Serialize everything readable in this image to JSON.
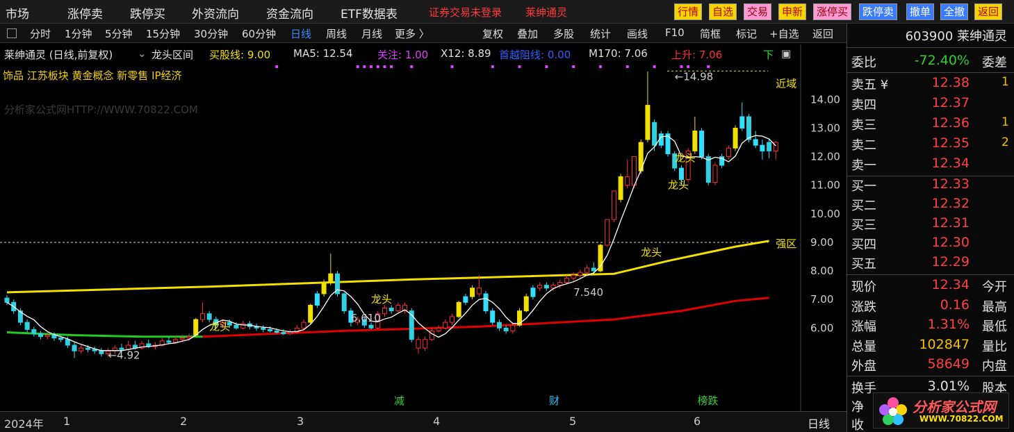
{
  "top_menu": {
    "items": [
      "市场",
      "涨停卖",
      "跌停买",
      "外资流向",
      "资金流向",
      "ETF数据表"
    ],
    "login_text": "证券交易未登录",
    "stock_name": "莱绅通灵",
    "quick_buttons": [
      {
        "label": "行情",
        "color": "#f5d400"
      },
      {
        "label": "自选",
        "color": "#f5d400"
      },
      {
        "label": "交易",
        "color": "#ff9ad5"
      },
      {
        "label": "申新",
        "color": "#f5d400"
      },
      {
        "label": "涨停买",
        "color": "#ff9ad5"
      },
      {
        "label": "跌停卖",
        "color": "#3a7bff"
      },
      {
        "label": "撤单",
        "color": "#3a7bff"
      },
      {
        "label": "全撤",
        "color": "#3a7bff"
      },
      {
        "label": "返回",
        "color": "#f5d400"
      }
    ]
  },
  "toolbar": {
    "periods": [
      "分时",
      "1分钟",
      "5分钟",
      "15分钟",
      "30分钟",
      "60分钟",
      "日线",
      "周线",
      "月线",
      "更多 〉"
    ],
    "active_period": "日线",
    "actions": [
      "复权",
      "叠加",
      "多股",
      "统计",
      "画线",
      "F10",
      "简框",
      "标记",
      "+自选",
      "返回"
    ]
  },
  "chart_header": {
    "title": "莱绅通灵 (日线,前复权)",
    "formula": "龙头区间",
    "indicators": [
      {
        "text": "买股线: 9.00",
        "color": "#f2e000"
      },
      {
        "text": "MA5: 12.54",
        "color": "#e0e0e0"
      },
      {
        "text": "关注: 1.00",
        "color": "#e040ff"
      },
      {
        "text": "X12: 8.89",
        "color": "#e0e0e0"
      },
      {
        "text": "首越阻线: 0.00",
        "color": "#3060ff"
      },
      {
        "text": "M170: 7.06",
        "color": "#e0e0e0"
      },
      {
        "text": "上升: 7.06",
        "color": "#ff3030"
      },
      {
        "text": "下",
        "color": "#30e030"
      }
    ],
    "tags": "饰品 江苏板块 黄金概念 新零售 IP经济",
    "watermark": "分析家公式网HTTP://WWW.70822.COM"
  },
  "quote": {
    "code_name": "603900 莱绅通灵",
    "ratio_label": "委比",
    "ratio_value": "-72.40%",
    "ratio_right": "委差",
    "sell": [
      {
        "label": "卖五 ¥",
        "price": "12.38",
        "vol": "1"
      },
      {
        "label": "卖四",
        "price": "12.37",
        "vol": ""
      },
      {
        "label": "卖三",
        "price": "12.36",
        "vol": "1"
      },
      {
        "label": "卖二",
        "price": "12.35",
        "vol": "2"
      },
      {
        "label": "卖一",
        "price": "12.34",
        "vol": ""
      }
    ],
    "buy": [
      {
        "label": "买一",
        "price": "12.33"
      },
      {
        "label": "买二",
        "price": "12.32"
      },
      {
        "label": "买三",
        "price": "12.31"
      },
      {
        "label": "买四",
        "price": "12.30"
      },
      {
        "label": "买五",
        "price": "12.29"
      }
    ],
    "stats": [
      {
        "label": "现价",
        "value": "12.34",
        "right": "今开",
        "color": "#ff4040"
      },
      {
        "label": "涨跌",
        "value": "0.16",
        "right": "最高",
        "color": "#ff4040"
      },
      {
        "label": "涨幅",
        "value": "1.31%",
        "right": "最低",
        "color": "#ff4040"
      },
      {
        "label": "总量",
        "value": "102847",
        "right": "量比",
        "color": "#f2c000"
      },
      {
        "label": "外盘",
        "value": "58649",
        "right": "内盘",
        "color": "#ff4040"
      }
    ],
    "turnover_label": "换手",
    "turnover_value": "3.01%",
    "turnover_right": "股本",
    "net_label": "净",
    "income_label": "收"
  },
  "bottom_axis": {
    "year": "2024年",
    "months": [
      "1",
      "2",
      "3",
      "4",
      "5",
      "6"
    ],
    "period_label": "日线"
  },
  "logo": {
    "text": "分析家公式网",
    "url": "WWW.70822.COM"
  },
  "chart_data": {
    "type": "candlestick",
    "y_ticks": [
      "14.00",
      "13.00",
      "12.00",
      "11.00",
      "10.00",
      "9.00",
      "8.00",
      "7.00",
      "6.00"
    ],
    "ylim": [
      4.5,
      15.2
    ],
    "candles": [
      {
        "o": 7.05,
        "c": 6.9,
        "h": 7.15,
        "l": 6.8,
        "kind": "down"
      },
      {
        "o": 6.9,
        "c": 6.6,
        "h": 7.0,
        "l": 6.5,
        "kind": "down"
      },
      {
        "o": 6.6,
        "c": 6.2,
        "h": 6.7,
        "l": 6.1,
        "kind": "down"
      },
      {
        "o": 6.2,
        "c": 5.95,
        "h": 6.3,
        "l": 5.85,
        "kind": "down"
      },
      {
        "o": 5.95,
        "c": 5.8,
        "h": 6.05,
        "l": 5.7,
        "kind": "down"
      },
      {
        "o": 5.8,
        "c": 5.7,
        "h": 5.9,
        "l": 5.6,
        "kind": "down"
      },
      {
        "o": 5.7,
        "c": 5.75,
        "h": 5.85,
        "l": 5.6,
        "kind": "up"
      },
      {
        "o": 5.75,
        "c": 5.65,
        "h": 5.85,
        "l": 5.55,
        "kind": "down"
      },
      {
        "o": 5.65,
        "c": 5.6,
        "h": 5.75,
        "l": 5.5,
        "kind": "down"
      },
      {
        "o": 5.6,
        "c": 5.4,
        "h": 5.7,
        "l": 5.3,
        "kind": "down"
      },
      {
        "o": 5.4,
        "c": 5.2,
        "h": 5.5,
        "l": 4.95,
        "kind": "down"
      },
      {
        "o": 5.2,
        "c": 5.3,
        "h": 5.4,
        "l": 5.1,
        "kind": "up"
      },
      {
        "o": 5.3,
        "c": 5.25,
        "h": 5.4,
        "l": 5.15,
        "kind": "down"
      },
      {
        "o": 5.25,
        "c": 5.2,
        "h": 5.35,
        "l": 5.1,
        "kind": "down"
      },
      {
        "o": 5.2,
        "c": 5.1,
        "h": 5.3,
        "l": 5.0,
        "kind": "down"
      },
      {
        "o": 5.1,
        "c": 5.2,
        "h": 5.3,
        "l": 5.0,
        "kind": "up"
      },
      {
        "o": 5.2,
        "c": 5.3,
        "h": 5.4,
        "l": 5.1,
        "kind": "up"
      },
      {
        "o": 5.3,
        "c": 5.25,
        "h": 5.45,
        "l": 5.15,
        "kind": "down"
      },
      {
        "o": 5.25,
        "c": 5.4,
        "h": 5.55,
        "l": 5.2,
        "kind": "up"
      },
      {
        "o": 5.4,
        "c": 5.3,
        "h": 5.55,
        "l": 5.25,
        "kind": "down"
      },
      {
        "o": 5.3,
        "c": 5.45,
        "h": 5.55,
        "l": 5.25,
        "kind": "up"
      },
      {
        "o": 5.45,
        "c": 5.35,
        "h": 5.6,
        "l": 5.3,
        "kind": "down"
      },
      {
        "o": 5.35,
        "c": 5.4,
        "h": 5.5,
        "l": 5.25,
        "kind": "up"
      },
      {
        "o": 5.4,
        "c": 5.55,
        "h": 5.65,
        "l": 5.35,
        "kind": "up"
      },
      {
        "o": 5.55,
        "c": 5.5,
        "h": 5.7,
        "l": 5.45,
        "kind": "down"
      },
      {
        "o": 5.5,
        "c": 5.6,
        "h": 5.7,
        "l": 5.45,
        "kind": "up"
      },
      {
        "o": 5.6,
        "c": 5.65,
        "h": 5.75,
        "l": 5.5,
        "kind": "up"
      },
      {
        "o": 5.65,
        "c": 5.7,
        "h": 5.8,
        "l": 5.55,
        "kind": "up"
      },
      {
        "o": 5.75,
        "c": 6.3,
        "h": 6.35,
        "l": 5.7,
        "kind": "yellow"
      },
      {
        "o": 6.3,
        "c": 6.5,
        "h": 6.9,
        "l": 6.2,
        "kind": "up"
      },
      {
        "o": 6.5,
        "c": 6.3,
        "h": 6.6,
        "l": 6.2,
        "kind": "down"
      },
      {
        "o": 6.3,
        "c": 6.1,
        "h": 6.4,
        "l": 6.0,
        "kind": "down"
      },
      {
        "o": 6.1,
        "c": 6.2,
        "h": 6.3,
        "l": 6.0,
        "kind": "up"
      },
      {
        "o": 6.2,
        "c": 6.1,
        "h": 6.3,
        "l": 6.0,
        "kind": "down"
      },
      {
        "o": 6.1,
        "c": 6.0,
        "h": 6.2,
        "l": 5.95,
        "kind": "down"
      },
      {
        "o": 6.0,
        "c": 6.15,
        "h": 6.25,
        "l": 5.95,
        "kind": "up"
      },
      {
        "o": 6.15,
        "c": 6.05,
        "h": 6.25,
        "l": 5.95,
        "kind": "down"
      },
      {
        "o": 6.05,
        "c": 6.0,
        "h": 6.15,
        "l": 5.9,
        "kind": "down"
      },
      {
        "o": 6.0,
        "c": 5.95,
        "h": 6.1,
        "l": 5.85,
        "kind": "down"
      },
      {
        "o": 5.95,
        "c": 5.9,
        "h": 6.05,
        "l": 5.85,
        "kind": "down"
      },
      {
        "o": 5.9,
        "c": 5.85,
        "h": 6.0,
        "l": 5.8,
        "kind": "down"
      },
      {
        "o": 5.85,
        "c": 5.8,
        "h": 5.95,
        "l": 5.75,
        "kind": "down"
      },
      {
        "o": 5.8,
        "c": 5.85,
        "h": 5.95,
        "l": 5.75,
        "kind": "up"
      },
      {
        "o": 5.85,
        "c": 6.0,
        "h": 6.1,
        "l": 5.8,
        "kind": "up"
      },
      {
        "o": 6.0,
        "c": 6.2,
        "h": 6.3,
        "l": 5.95,
        "kind": "up"
      },
      {
        "o": 6.2,
        "c": 6.8,
        "h": 6.85,
        "l": 6.15,
        "kind": "yellow"
      },
      {
        "o": 6.8,
        "c": 7.2,
        "h": 7.3,
        "l": 6.7,
        "kind": "cyan"
      },
      {
        "o": 7.2,
        "c": 7.6,
        "h": 7.7,
        "l": 7.1,
        "kind": "yellow"
      },
      {
        "o": 7.6,
        "c": 7.9,
        "h": 8.6,
        "l": 7.5,
        "kind": "yellow"
      },
      {
        "o": 7.9,
        "c": 7.2,
        "h": 8.0,
        "l": 7.1,
        "kind": "down"
      },
      {
        "o": 7.2,
        "c": 6.6,
        "h": 7.25,
        "l": 6.5,
        "kind": "down"
      },
      {
        "o": 6.6,
        "c": 6.2,
        "h": 6.7,
        "l": 6.05,
        "kind": "cyan"
      },
      {
        "o": 6.2,
        "c": 6.3,
        "h": 6.4,
        "l": 6.1,
        "kind": "up"
      },
      {
        "o": 6.3,
        "c": 6.1,
        "h": 6.4,
        "l": 6.0,
        "kind": "down"
      },
      {
        "o": 6.1,
        "c": 6.0,
        "h": 6.2,
        "l": 5.95,
        "kind": "down"
      },
      {
        "o": 6.0,
        "c": 6.5,
        "h": 6.6,
        "l": 5.95,
        "kind": "up"
      },
      {
        "o": 6.5,
        "c": 6.7,
        "h": 6.8,
        "l": 6.4,
        "kind": "up"
      },
      {
        "o": 6.7,
        "c": 6.6,
        "h": 6.8,
        "l": 6.5,
        "kind": "down"
      },
      {
        "o": 6.6,
        "c": 6.8,
        "h": 6.9,
        "l": 6.55,
        "kind": "up"
      },
      {
        "o": 6.8,
        "c": 6.6,
        "h": 6.9,
        "l": 6.5,
        "kind": "up"
      },
      {
        "o": 6.6,
        "c": 5.6,
        "h": 6.7,
        "l": 5.5,
        "kind": "down"
      },
      {
        "o": 5.6,
        "c": 5.3,
        "h": 5.7,
        "l": 5.1,
        "kind": "up"
      },
      {
        "o": 5.3,
        "c": 5.6,
        "h": 5.7,
        "l": 5.2,
        "kind": "up"
      },
      {
        "o": 5.6,
        "c": 5.9,
        "h": 6.0,
        "l": 5.55,
        "kind": "up"
      },
      {
        "o": 5.9,
        "c": 6.0,
        "h": 6.1,
        "l": 5.85,
        "kind": "up"
      },
      {
        "o": 6.0,
        "c": 6.2,
        "h": 6.3,
        "l": 5.95,
        "kind": "up"
      },
      {
        "o": 6.2,
        "c": 6.4,
        "h": 6.5,
        "l": 6.1,
        "kind": "up"
      },
      {
        "o": 6.4,
        "c": 6.9,
        "h": 6.95,
        "l": 6.35,
        "kind": "yellow"
      },
      {
        "o": 6.9,
        "c": 7.1,
        "h": 7.2,
        "l": 6.8,
        "kind": "cyan"
      },
      {
        "o": 7.1,
        "c": 7.4,
        "h": 7.5,
        "l": 7.0,
        "kind": "yellow"
      },
      {
        "o": 7.4,
        "c": 7.2,
        "h": 7.85,
        "l": 7.1,
        "kind": "up"
      },
      {
        "o": 7.2,
        "c": 6.6,
        "h": 7.3,
        "l": 6.5,
        "kind": "cyan"
      },
      {
        "o": 6.6,
        "c": 6.2,
        "h": 6.7,
        "l": 6.1,
        "kind": "cyan"
      },
      {
        "o": 6.2,
        "c": 6.0,
        "h": 6.3,
        "l": 5.9,
        "kind": "down"
      },
      {
        "o": 6.0,
        "c": 5.9,
        "h": 6.1,
        "l": 5.8,
        "kind": "down"
      },
      {
        "o": 5.9,
        "c": 6.1,
        "h": 6.2,
        "l": 5.8,
        "kind": "up"
      },
      {
        "o": 6.1,
        "c": 6.6,
        "h": 6.7,
        "l": 6.05,
        "kind": "yellow"
      },
      {
        "o": 6.6,
        "c": 7.1,
        "h": 7.2,
        "l": 6.55,
        "kind": "yellow"
      },
      {
        "o": 7.1,
        "c": 7.4,
        "h": 7.5,
        "l": 7.0,
        "kind": "cyan"
      },
      {
        "o": 7.4,
        "c": 7.5,
        "h": 7.6,
        "l": 7.3,
        "kind": "up"
      },
      {
        "o": 7.5,
        "c": 7.4,
        "h": 7.6,
        "l": 7.3,
        "kind": "down"
      },
      {
        "o": 7.4,
        "c": 7.5,
        "h": 7.6,
        "l": 7.3,
        "kind": "up"
      },
      {
        "o": 7.5,
        "c": 7.6,
        "h": 7.7,
        "l": 7.4,
        "kind": "up"
      },
      {
        "o": 7.6,
        "c": 7.75,
        "h": 7.85,
        "l": 7.55,
        "kind": "up"
      },
      {
        "o": 7.75,
        "c": 7.85,
        "h": 7.95,
        "l": 7.65,
        "kind": "up"
      },
      {
        "o": 7.85,
        "c": 7.95,
        "h": 8.05,
        "l": 7.75,
        "kind": "up"
      },
      {
        "o": 7.95,
        "c": 8.1,
        "h": 8.2,
        "l": 7.85,
        "kind": "up"
      },
      {
        "o": 8.1,
        "c": 8.0,
        "h": 8.3,
        "l": 7.9,
        "kind": "down"
      },
      {
        "o": 8.0,
        "c": 8.9,
        "h": 8.95,
        "l": 7.95,
        "kind": "yellow"
      },
      {
        "o": 8.9,
        "c": 9.8,
        "h": 9.8,
        "l": 8.85,
        "kind": "up"
      },
      {
        "o": 9.8,
        "c": 10.8,
        "h": 10.8,
        "l": 9.7,
        "kind": "up"
      },
      {
        "o": 10.5,
        "c": 11.3,
        "h": 11.4,
        "l": 10.4,
        "kind": "yellow"
      },
      {
        "o": 11.3,
        "c": 11.0,
        "h": 11.9,
        "l": 10.9,
        "kind": "up"
      },
      {
        "o": 11.0,
        "c": 12.0,
        "h": 12.0,
        "l": 10.9,
        "kind": "up"
      },
      {
        "o": 11.5,
        "c": 12.5,
        "h": 12.6,
        "l": 11.4,
        "kind": "yellow"
      },
      {
        "o": 12.6,
        "c": 13.8,
        "h": 14.98,
        "l": 12.5,
        "kind": "yellow"
      },
      {
        "o": 13.2,
        "c": 12.4,
        "h": 13.3,
        "l": 12.2,
        "kind": "down"
      },
      {
        "o": 12.4,
        "c": 12.8,
        "h": 12.9,
        "l": 12.3,
        "kind": "cyan"
      },
      {
        "o": 12.8,
        "c": 12.1,
        "h": 12.9,
        "l": 12.0,
        "kind": "cyan"
      },
      {
        "o": 12.1,
        "c": 11.6,
        "h": 12.2,
        "l": 11.5,
        "kind": "down"
      },
      {
        "o": 11.6,
        "c": 11.2,
        "h": 11.7,
        "l": 11.0,
        "kind": "cyan"
      },
      {
        "o": 11.2,
        "c": 12.2,
        "h": 12.3,
        "l": 11.1,
        "kind": "up"
      },
      {
        "o": 12.2,
        "c": 12.9,
        "h": 13.4,
        "l": 12.1,
        "kind": "yellow"
      },
      {
        "o": 12.9,
        "c": 12.0,
        "h": 13.0,
        "l": 11.9,
        "kind": "cyan"
      },
      {
        "o": 12.0,
        "c": 11.1,
        "h": 12.1,
        "l": 11.0,
        "kind": "down"
      },
      {
        "o": 11.1,
        "c": 11.7,
        "h": 11.8,
        "l": 11.0,
        "kind": "up"
      },
      {
        "o": 11.7,
        "c": 12.0,
        "h": 12.1,
        "l": 11.6,
        "kind": "cyan"
      },
      {
        "o": 12.0,
        "c": 12.3,
        "h": 12.4,
        "l": 11.9,
        "kind": "up"
      },
      {
        "o": 12.3,
        "c": 13.0,
        "h": 13.1,
        "l": 12.2,
        "kind": "yellow"
      },
      {
        "o": 13.0,
        "c": 13.4,
        "h": 13.9,
        "l": 12.9,
        "kind": "cyan"
      },
      {
        "o": 13.4,
        "c": 12.6,
        "h": 13.5,
        "l": 12.5,
        "kind": "down"
      },
      {
        "o": 12.6,
        "c": 12.4,
        "h": 12.9,
        "l": 12.3,
        "kind": "cyan"
      },
      {
        "o": 12.4,
        "c": 12.2,
        "h": 12.6,
        "l": 11.9,
        "kind": "cyan"
      },
      {
        "o": 12.2,
        "c": 12.5,
        "h": 12.6,
        "l": 11.95,
        "kind": "down"
      },
      {
        "o": 12.5,
        "c": 12.2,
        "h": 12.55,
        "l": 11.9,
        "kind": "up"
      }
    ],
    "lines": [
      {
        "name": "yellow",
        "color": "#f2e000",
        "points": [
          [
            0,
            7.25
          ],
          [
            30,
            7.45
          ],
          [
            60,
            7.7
          ],
          [
            90,
            7.9
          ],
          [
            98,
            8.35
          ],
          [
            108,
            8.85
          ],
          [
            113,
            9.05
          ]
        ]
      },
      {
        "name": "red",
        "color": "#e00000",
        "points": [
          [
            29,
            5.7
          ],
          [
            50,
            5.9
          ],
          [
            70,
            6.05
          ],
          [
            90,
            6.3
          ],
          [
            100,
            6.6
          ],
          [
            108,
            6.95
          ],
          [
            113,
            7.06
          ]
        ]
      },
      {
        "name": "green",
        "color": "#22cc22",
        "points": [
          [
            0,
            5.85
          ],
          [
            10,
            5.75
          ],
          [
            20,
            5.7
          ],
          [
            29,
            5.7
          ]
        ]
      }
    ],
    "annotations": [
      {
        "text": "←4.92",
        "x": 15,
        "y": 5.05,
        "color": "#cccccc"
      },
      {
        "text": "龙头",
        "x": 30,
        "y": 6.05,
        "color": "#f2e000"
      },
      {
        "text": "6.610",
        "x": 51,
        "y": 6.35,
        "color": "#cccccc"
      },
      {
        "text": "龙头",
        "x": 54,
        "y": 7.0,
        "color": "#f2e000"
      },
      {
        "text": "7.540",
        "x": 84,
        "y": 7.25,
        "color": "#cccccc"
      },
      {
        "text": "龙头",
        "x": 94,
        "y": 8.65,
        "color": "#f2e000"
      },
      {
        "text": "龙头",
        "x": 98,
        "y": 11.0,
        "color": "#f2e000"
      },
      {
        "text": "龙头",
        "x": 99,
        "y": 11.95,
        "color": "#f2e000"
      },
      {
        "text": "←14.98",
        "x": 99,
        "y": 14.8,
        "color": "#cccccc"
      },
      {
        "text": "强区",
        "x": 114,
        "y": 8.95,
        "color": "#f2e000"
      },
      {
        "text": "近域",
        "x": 114,
        "y": 14.55,
        "color": "#f2e000"
      }
    ],
    "markers": [
      {
        "text": "减",
        "x": 58,
        "color": "#30d030"
      },
      {
        "text": "财",
        "x": 81,
        "color": "#30c0ff"
      },
      {
        "text": "榜跌",
        "x": 103,
        "color": "#30d030"
      }
    ]
  }
}
